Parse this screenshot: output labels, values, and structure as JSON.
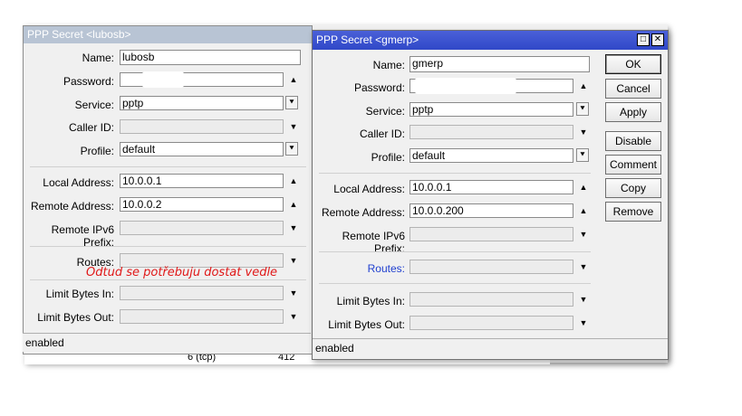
{
  "background": {
    "row": {
      "col1": "6 (tcp)",
      "col2": "412"
    }
  },
  "window_a": {
    "title": "PPP Secret <lubosb>",
    "name_label": "Name:",
    "name_value": "lubosb",
    "password_label": "Password:",
    "service_label": "Service:",
    "service_value": "pptp",
    "caller_id_label": "Caller ID:",
    "profile_label": "Profile:",
    "profile_value": "default",
    "local_address_label": "Local Address:",
    "local_address_value": "10.0.0.1",
    "remote_address_label": "Remote Address:",
    "remote_address_value": "10.0.0.2",
    "remote_ipv6_label": "Remote IPv6 Prefix:",
    "routes_label": "Routes:",
    "limit_in_label": "Limit Bytes In:",
    "limit_out_label": "Limit Bytes Out:",
    "status": "enabled",
    "annotation": "Odtud se potřebuju dostat vedle",
    "annotation_color": "#e01818"
  },
  "window_b": {
    "title": "PPP Secret <gmerp>",
    "name_label": "Name:",
    "name_value": "gmerp",
    "password_label": "Password:",
    "service_label": "Service:",
    "service_value": "pptp",
    "caller_id_label": "Caller ID:",
    "profile_label": "Profile:",
    "profile_value": "default",
    "local_address_label": "Local Address:",
    "local_address_value": "10.0.0.1",
    "remote_address_label": "Remote Address:",
    "remote_address_value": "10.0.0.200",
    "remote_ipv6_label": "Remote IPv6 Prefix:",
    "routes_label": "Routes:",
    "limit_in_label": "Limit Bytes In:",
    "limit_out_label": "Limit Bytes Out:",
    "status": "enabled",
    "buttons": {
      "ok": "OK",
      "cancel": "Cancel",
      "apply": "Apply",
      "disable": "Disable",
      "comment": "Comment",
      "copy": "Copy",
      "remove": "Remove"
    },
    "title_color": "#3048c8",
    "routes_label_color": "#1f3fcf"
  },
  "icons": {
    "up_arrow": "▲",
    "down_arrow": "▼",
    "dropdown": "⯆",
    "maximize": "□",
    "close": "✕"
  }
}
